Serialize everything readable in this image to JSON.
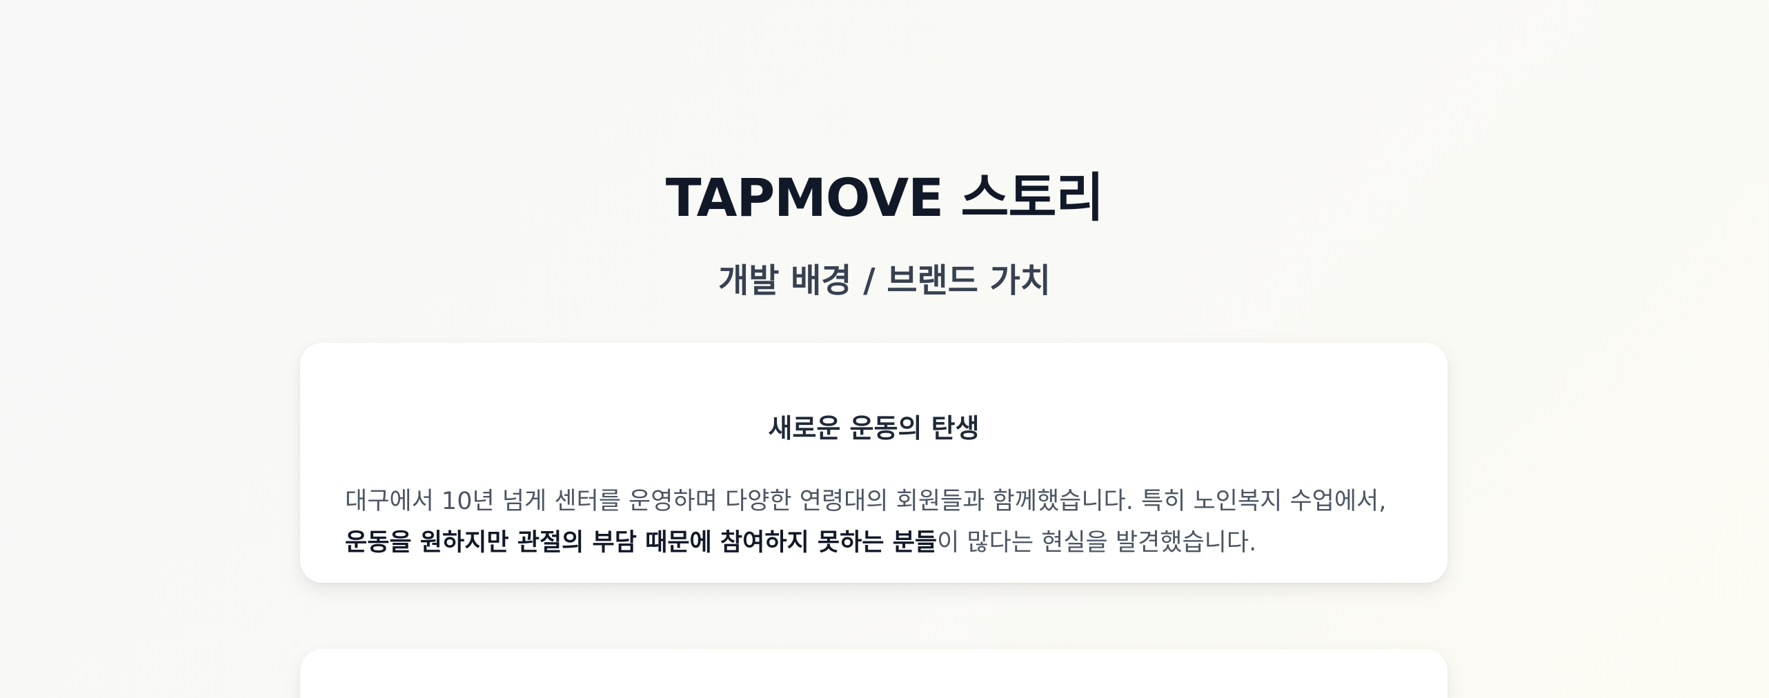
{
  "header": {
    "title": "TAPMOVE 스토리",
    "subtitle": "개발 배경 / 브랜드 가치"
  },
  "cards": [
    {
      "heading": "새로운 운동의 탄생",
      "line1": "대구에서 10년 넘게 센터를 운영하며 다양한 연령대의 회원들과 함께했습니다. 특히 노인복지 수업에서,",
      "line2_bold": "운동을 원하지만 관절의 부담 때문에 참여하지 못하는 분들",
      "line2_rest": "이 많다는 현실을 발견했습니다."
    }
  ],
  "colors": {
    "title": "#111827",
    "subtitle": "#374151",
    "body_text": "#4b5563",
    "card_background": "#ffffff"
  }
}
